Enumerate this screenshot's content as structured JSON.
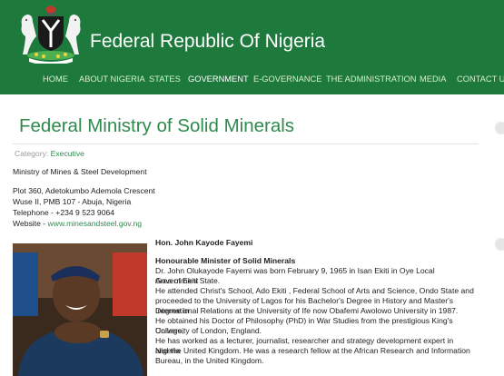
{
  "header": {
    "site_title": "Federal Republic Of Nigeria",
    "nav": [
      "HOME",
      "ABOUT NIGERIA",
      "STATES",
      "GOVERNMENT",
      "E-GOVERNANCE",
      "THE ADMINISTRATION",
      "MEDIA",
      "CONTACT US"
    ],
    "active_nav": "GOVERNMENT",
    "bg_color": "#1d7a3c"
  },
  "article": {
    "title": "Federal Ministry of Solid Minerals",
    "category_label": "Category:",
    "category_value": "Executive",
    "ministry_name": "Ministry of Mines & Steel Development",
    "address_line1": "Plot 360, Adetokumbo Ademola Crescent",
    "address_line2": "Wuse II, PMB 107 - Abuja, Nigeria",
    "telephone": "Telephone - +234 9 523 9064",
    "website_label": "Website - ",
    "website_url": "www.minesandsteel.gov.ng"
  },
  "minister": {
    "name": "Hon. John Kayode Fayemi",
    "role": "Honourable Minister of Solid Minerals",
    "bio_lines": [
      "Dr. John Olukayode Fayemi was born February 9, 1965 in Isan Ekiti in Oye Local Government",
      "Area of Ekiti State.",
      "He attended Christ's School, Ado Ekiti , Federal School of Arts and Science, Ondo State and",
      "proceeded to the University of Lagos for his Bachelor's Degree in History and Master's Degree in",
      "International Relations at the University of Ife now Obafemi Awolowo University in 1987.",
      "He obtained his Doctor of Philosophy (PhD) in War Studies from the prestigious King's College,",
      "University of London, England.",
      "He has worked as a lecturer, journalist, researcher and strategy development expert in Nigeria",
      "and the United Kingdom. He was a research fellow at the African Research and Information",
      "Bureau, in the United Kingdom."
    ]
  },
  "accent_color": "#2f8a4e"
}
